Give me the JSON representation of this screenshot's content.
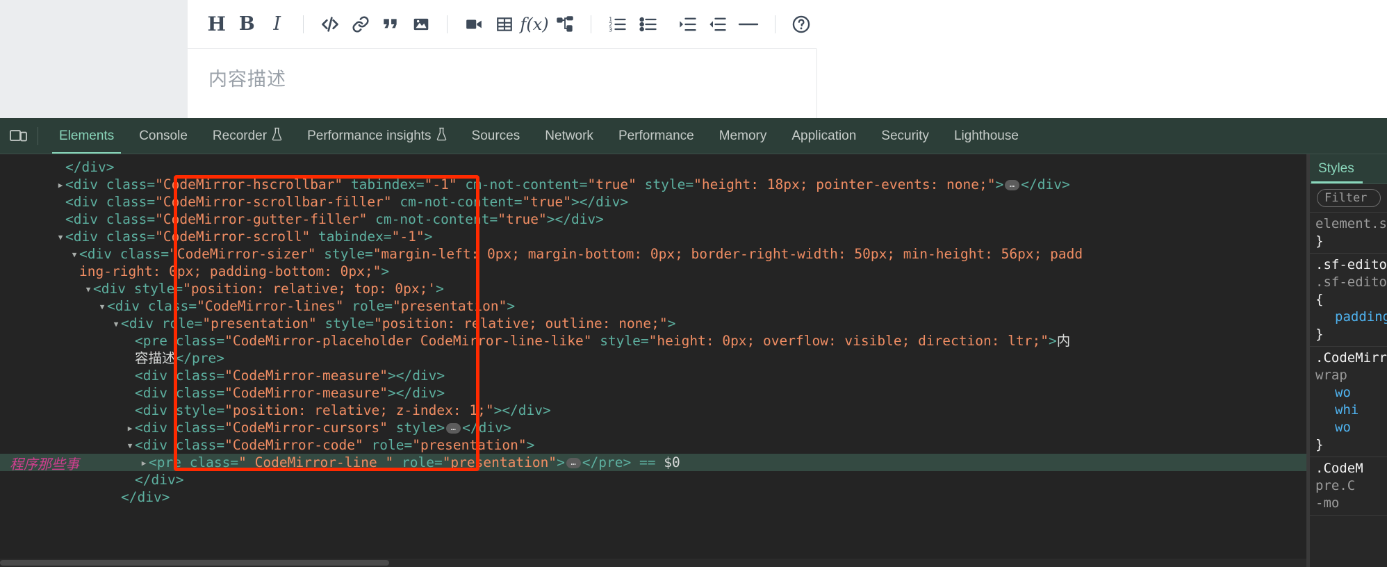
{
  "editor": {
    "placeholder": "内容描述",
    "toolbar_groups": [
      [
        {
          "name": "heading-button",
          "label": "H",
          "icon": "heading-icon"
        },
        {
          "name": "bold-button",
          "label": "B",
          "icon": "bold-icon"
        },
        {
          "name": "italic-button",
          "label": "I",
          "icon": "italic-icon"
        }
      ],
      [
        {
          "name": "code-button",
          "label": "",
          "icon": "code-icon"
        },
        {
          "name": "link-button",
          "label": "",
          "icon": "link-icon"
        },
        {
          "name": "quote-button",
          "label": "",
          "icon": "quote-icon"
        },
        {
          "name": "image-button",
          "label": "",
          "icon": "image-icon"
        }
      ],
      [
        {
          "name": "video-button",
          "label": "",
          "icon": "video-icon"
        },
        {
          "name": "table-button",
          "label": "",
          "icon": "table-icon"
        },
        {
          "name": "formula-button",
          "label": "",
          "icon": "formula-icon"
        },
        {
          "name": "mindmap-button",
          "label": "",
          "icon": "mindmap-icon"
        }
      ],
      [
        {
          "name": "ordered-list-button",
          "label": "",
          "icon": "ordered-list-icon"
        },
        {
          "name": "bullet-list-button",
          "label": "",
          "icon": "bullet-list-icon"
        },
        {
          "name": "indent-button",
          "label": "",
          "icon": "indent-icon"
        },
        {
          "name": "outdent-button",
          "label": "",
          "icon": "outdent-icon"
        },
        {
          "name": "horizontal-rule-button",
          "label": "",
          "icon": "horizontal-rule-icon"
        }
      ],
      [
        {
          "name": "help-button",
          "label": "",
          "icon": "help-icon"
        }
      ]
    ]
  },
  "devtools": {
    "dock_icon": "device-toolbar-icon",
    "tabs": [
      {
        "label": "Elements",
        "active": true,
        "flask": false
      },
      {
        "label": "Console",
        "active": false,
        "flask": false
      },
      {
        "label": "Recorder",
        "active": false,
        "flask": true
      },
      {
        "label": "Performance insights",
        "active": false,
        "flask": true
      },
      {
        "label": "Sources",
        "active": false,
        "flask": false
      },
      {
        "label": "Network",
        "active": false,
        "flask": false
      },
      {
        "label": "Performance",
        "active": false,
        "flask": false
      },
      {
        "label": "Memory",
        "active": false,
        "flask": false
      },
      {
        "label": "Application",
        "active": false,
        "flask": false
      },
      {
        "label": "Security",
        "active": false,
        "flask": false
      },
      {
        "label": "Lighthouse",
        "active": false,
        "flask": false
      }
    ],
    "dom_lines": [
      {
        "indent": 4,
        "twisty": "none",
        "parts": [
          {
            "t": "tag",
            "s": "</div>"
          }
        ]
      },
      {
        "indent": 4,
        "twisty": "closed",
        "parts": [
          {
            "t": "tag",
            "s": "<div "
          },
          {
            "t": "attr",
            "s": "class"
          },
          {
            "t": "eq",
            "s": "="
          },
          {
            "t": "val",
            "s": "\"CodeMirror-hscrollbar\""
          },
          {
            "t": "plain",
            "s": " "
          },
          {
            "t": "attr",
            "s": "tabindex"
          },
          {
            "t": "eq",
            "s": "="
          },
          {
            "t": "val",
            "s": "\"-1\""
          },
          {
            "t": "plain",
            "s": " "
          },
          {
            "t": "attr",
            "s": "cm-not-content"
          },
          {
            "t": "eq",
            "s": "="
          },
          {
            "t": "val",
            "s": "\"true\""
          },
          {
            "t": "plain",
            "s": " "
          },
          {
            "t": "attr",
            "s": "style"
          },
          {
            "t": "eq",
            "s": "="
          },
          {
            "t": "val",
            "s": "\"height: 18px; pointer-events: none;\""
          },
          {
            "t": "tag",
            "s": ">"
          },
          {
            "t": "badge",
            "s": "…"
          },
          {
            "t": "tag",
            "s": "</div>"
          }
        ]
      },
      {
        "indent": 4,
        "twisty": "none",
        "parts": [
          {
            "t": "tag",
            "s": "<div "
          },
          {
            "t": "attr",
            "s": "class"
          },
          {
            "t": "eq",
            "s": "="
          },
          {
            "t": "val",
            "s": "\"CodeMirror-scrollbar-filler\""
          },
          {
            "t": "plain",
            "s": " "
          },
          {
            "t": "attr",
            "s": "cm-not-content"
          },
          {
            "t": "eq",
            "s": "="
          },
          {
            "t": "val",
            "s": "\"true\""
          },
          {
            "t": "tag",
            "s": "></div>"
          }
        ]
      },
      {
        "indent": 4,
        "twisty": "none",
        "parts": [
          {
            "t": "tag",
            "s": "<div "
          },
          {
            "t": "attr",
            "s": "class"
          },
          {
            "t": "eq",
            "s": "="
          },
          {
            "t": "val",
            "s": "\"CodeMirror-gutter-filler\""
          },
          {
            "t": "plain",
            "s": " "
          },
          {
            "t": "attr",
            "s": "cm-not-content"
          },
          {
            "t": "eq",
            "s": "="
          },
          {
            "t": "val",
            "s": "\"true\""
          },
          {
            "t": "tag",
            "s": "></div>"
          }
        ]
      },
      {
        "indent": 4,
        "twisty": "open",
        "parts": [
          {
            "t": "tag",
            "s": "<div "
          },
          {
            "t": "attr",
            "s": "class"
          },
          {
            "t": "eq",
            "s": "="
          },
          {
            "t": "val",
            "s": "\"CodeMirror-scroll\""
          },
          {
            "t": "plain",
            "s": " "
          },
          {
            "t": "attr",
            "s": "tabindex"
          },
          {
            "t": "eq",
            "s": "="
          },
          {
            "t": "val",
            "s": "\"-1\""
          },
          {
            "t": "tag",
            "s": ">"
          }
        ]
      },
      {
        "indent": 5,
        "twisty": "open",
        "parts": [
          {
            "t": "tag",
            "s": "<div "
          },
          {
            "t": "attr",
            "s": "class"
          },
          {
            "t": "eq",
            "s": "="
          },
          {
            "t": "val",
            "s": "\"CodeMirror-sizer\""
          },
          {
            "t": "plain",
            "s": " "
          },
          {
            "t": "attr",
            "s": "style"
          },
          {
            "t": "eq",
            "s": "="
          },
          {
            "t": "val",
            "s": "\"margin-left: 0px; margin-bottom: 0px; border-right-width: 50px; min-height: 56px; padd"
          }
        ]
      },
      {
        "indent": 5,
        "twisty": "none",
        "wrap": true,
        "parts": [
          {
            "t": "val",
            "s": "ing-right: 0px; padding-bottom: 0px;\""
          },
          {
            "t": "tag",
            "s": ">"
          }
        ]
      },
      {
        "indent": 6,
        "twisty": "open",
        "parts": [
          {
            "t": "tag",
            "s": "<div "
          },
          {
            "t": "attr",
            "s": "style"
          },
          {
            "t": "eq",
            "s": "="
          },
          {
            "t": "val",
            "s": "\"position: relative; top: 0px;'"
          },
          {
            "t": "tag",
            "s": ">"
          }
        ]
      },
      {
        "indent": 7,
        "twisty": "open",
        "parts": [
          {
            "t": "tag",
            "s": "<div "
          },
          {
            "t": "attr",
            "s": "class"
          },
          {
            "t": "eq",
            "s": "="
          },
          {
            "t": "val",
            "s": "\"CodeMirror-lines\""
          },
          {
            "t": "plain",
            "s": " "
          },
          {
            "t": "attr",
            "s": "role"
          },
          {
            "t": "eq",
            "s": "="
          },
          {
            "t": "val",
            "s": "\"presentation\""
          },
          {
            "t": "tag",
            "s": ">"
          }
        ]
      },
      {
        "indent": 8,
        "twisty": "open",
        "parts": [
          {
            "t": "tag",
            "s": "<div "
          },
          {
            "t": "attr",
            "s": "role"
          },
          {
            "t": "eq",
            "s": "="
          },
          {
            "t": "val",
            "s": "\"presentation\""
          },
          {
            "t": "plain",
            "s": " "
          },
          {
            "t": "attr",
            "s": "style"
          },
          {
            "t": "eq",
            "s": "="
          },
          {
            "t": "val",
            "s": "\"position: relative; outline: none;\""
          },
          {
            "t": "tag",
            "s": ">"
          }
        ]
      },
      {
        "indent": 9,
        "twisty": "none",
        "parts": [
          {
            "t": "tag",
            "s": "<pre "
          },
          {
            "t": "attr",
            "s": "class"
          },
          {
            "t": "eq",
            "s": "="
          },
          {
            "t": "val",
            "s": "\"CodeMirror-placeholder CodeMirror-line-like\""
          },
          {
            "t": "plain",
            "s": " "
          },
          {
            "t": "attr",
            "s": "style"
          },
          {
            "t": "eq",
            "s": "="
          },
          {
            "t": "val",
            "s": "\"height: 0px; overflow: visible; direction: ltr;\""
          },
          {
            "t": "tag",
            "s": ">"
          },
          {
            "t": "txt",
            "s": "内"
          }
        ]
      },
      {
        "indent": 9,
        "twisty": "none",
        "wrap": true,
        "parts": [
          {
            "t": "txt",
            "s": "容描述"
          },
          {
            "t": "tag",
            "s": "</pre>"
          }
        ]
      },
      {
        "indent": 9,
        "twisty": "none",
        "parts": [
          {
            "t": "tag",
            "s": "<div "
          },
          {
            "t": "attr",
            "s": "class"
          },
          {
            "t": "eq",
            "s": "="
          },
          {
            "t": "val",
            "s": "\"CodeMirror-measure\""
          },
          {
            "t": "tag",
            "s": "></div>"
          }
        ]
      },
      {
        "indent": 9,
        "twisty": "none",
        "parts": [
          {
            "t": "tag",
            "s": "<div "
          },
          {
            "t": "attr",
            "s": "class"
          },
          {
            "t": "eq",
            "s": "="
          },
          {
            "t": "val",
            "s": "\"CodeMirror-measure\""
          },
          {
            "t": "tag",
            "s": "></div>"
          }
        ]
      },
      {
        "indent": 9,
        "twisty": "none",
        "parts": [
          {
            "t": "tag",
            "s": "<div "
          },
          {
            "t": "attr",
            "s": "style"
          },
          {
            "t": "eq",
            "s": "="
          },
          {
            "t": "val",
            "s": "\"position: relative; z-index: 1;\""
          },
          {
            "t": "tag",
            "s": "></div>"
          }
        ]
      },
      {
        "indent": 9,
        "twisty": "closed",
        "parts": [
          {
            "t": "tag",
            "s": "<div "
          },
          {
            "t": "attr",
            "s": "class"
          },
          {
            "t": "eq",
            "s": "="
          },
          {
            "t": "val",
            "s": "\"CodeMirror-cursors\""
          },
          {
            "t": "plain",
            "s": " "
          },
          {
            "t": "attr",
            "s": "style"
          },
          {
            "t": "tag",
            "s": ">"
          },
          {
            "t": "badge",
            "s": "…"
          },
          {
            "t": "tag",
            "s": "</div>"
          }
        ]
      },
      {
        "indent": 9,
        "twisty": "open",
        "parts": [
          {
            "t": "tag",
            "s": "<div "
          },
          {
            "t": "attr",
            "s": "class"
          },
          {
            "t": "eq",
            "s": "="
          },
          {
            "t": "val",
            "s": "\"CodeMirror-code\""
          },
          {
            "t": "plain",
            "s": " "
          },
          {
            "t": "attr",
            "s": "role"
          },
          {
            "t": "eq",
            "s": "="
          },
          {
            "t": "val",
            "s": "\"presentation\""
          },
          {
            "t": "tag",
            "s": ">"
          }
        ]
      },
      {
        "indent": 10,
        "twisty": "closed",
        "selected": true,
        "parts": [
          {
            "t": "tag",
            "s": "<pre "
          },
          {
            "t": "attr",
            "s": "class"
          },
          {
            "t": "eq",
            "s": "="
          },
          {
            "t": "val",
            "s": "\" CodeMirror-line \""
          },
          {
            "t": "plain",
            "s": " "
          },
          {
            "t": "attr",
            "s": "role"
          },
          {
            "t": "eq",
            "s": "="
          },
          {
            "t": "val",
            "s": "\"presentation\""
          },
          {
            "t": "tag",
            "s": ">"
          },
          {
            "t": "badge",
            "s": "…"
          },
          {
            "t": "tag",
            "s": "</pre>"
          },
          {
            "t": "plain",
            "s": "  "
          },
          {
            "t": "eq",
            "s": "=="
          },
          {
            "t": "plain",
            "s": " "
          },
          {
            "t": "dollar",
            "s": "$0"
          }
        ]
      },
      {
        "indent": 9,
        "twisty": "none",
        "parts": [
          {
            "t": "tag",
            "s": "</div>"
          }
        ]
      },
      {
        "indent": 8,
        "twisty": "none",
        "parts": [
          {
            "t": "tag",
            "s": "</div>"
          }
        ]
      }
    ],
    "annotation": {
      "watermark": "程序那些事",
      "rect_color": "#ff2a00"
    },
    "styles_panel": {
      "tab_label": "Styles",
      "filter_placeholder": "Filter",
      "rules": [
        {
          "lines": [
            {
              "cls": "sel-g",
              "text": "element.style {"
            },
            {
              "cls": "brace",
              "text": "}"
            }
          ]
        },
        {
          "lines": [
            {
              "cls": "sel-w",
              "text": ".sf-editor-con"
            },
            {
              "cls": "sel-g",
              "text": ".sf-editor-con"
            },
            {
              "cls": "brace",
              "text": "{"
            },
            {
              "cls": "prop",
              "text": "padding"
            },
            {
              "cls": "brace",
              "text": "}"
            }
          ]
        },
        {
          "lines": [
            {
              "cls": "sel-w",
              "text": ".CodeMirror"
            },
            {
              "cls": "sel-g",
              "text": "wrap"
            },
            {
              "cls": "prop",
              "text": "wo"
            },
            {
              "cls": "prop",
              "text": "whi"
            },
            {
              "cls": "prop",
              "text": "wo"
            },
            {
              "cls": "brace",
              "text": "}"
            }
          ]
        },
        {
          "lines": [
            {
              "cls": "sel-w",
              "text": ".CodeM"
            },
            {
              "cls": "sel-g",
              "text": "pre.C"
            },
            {
              "cls": "dash",
              "text": "-mo"
            }
          ]
        }
      ]
    },
    "colors": {
      "tabbar_bg": "#2c3e38",
      "accent": "#8ad6bb",
      "dom_bg": "#242424",
      "tag": "#5db0a0",
      "value": "#f08d63",
      "text": "#cfd2d0",
      "selected_row": "#344a42",
      "property": "#4fb3f0",
      "annotation_red": "#ff2a00",
      "watermark": "#cf3f8f"
    }
  }
}
